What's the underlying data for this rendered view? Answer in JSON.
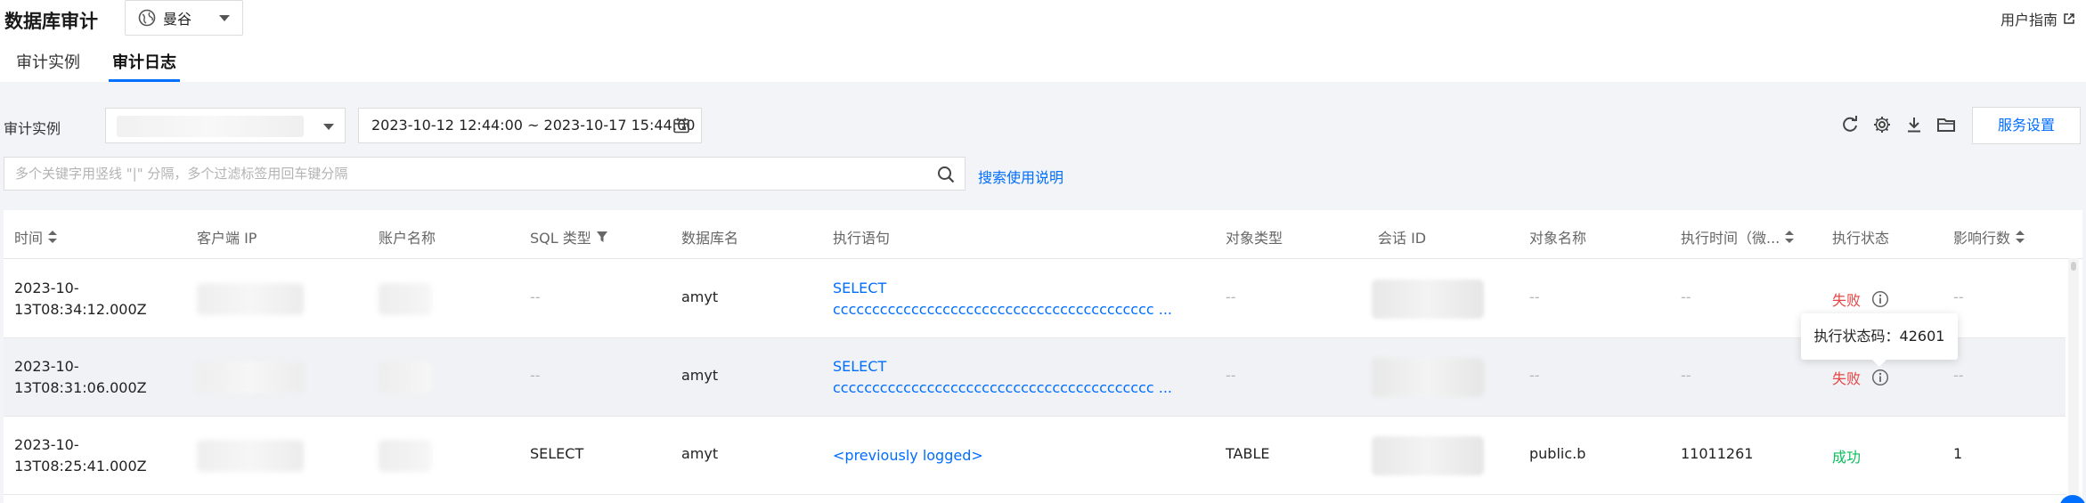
{
  "header": {
    "title": "数据库审计",
    "region": "曼谷",
    "guide": "用户指南"
  },
  "tabs": [
    {
      "label": "审计实例",
      "active": false
    },
    {
      "label": "审计日志",
      "active": true
    }
  ],
  "filters": {
    "instance_label": "审计实例",
    "date_range": "2023-10-12 12:44:00 ~ 2023-10-17 15:44:00",
    "service_button": "服务设置",
    "search_placeholder": "多个关键字用竖线 \"|\" 分隔，多个过滤标签用回车键分隔",
    "search_help": "搜索使用说明"
  },
  "toolbar_icons": [
    "refresh-icon",
    "settings-icon",
    "download-icon",
    "folder-icon"
  ],
  "table": {
    "columns": [
      "时间",
      "客户端 IP",
      "账户名称",
      "SQL 类型",
      "数据库名",
      "执行语句",
      "对象类型",
      "会话 ID",
      "对象名称",
      "执行时间（微...",
      "执行状态",
      "影响行数"
    ],
    "rows": [
      {
        "time_l1": "2023-10-",
        "time_l2": "13T08:34:12.000Z",
        "sql_type": "--",
        "db_name": "amyt",
        "stmt_l1": "SELECT",
        "stmt_l2": "ccccccccccccccccccccccccccccccccccccccccc ...",
        "obj_type": "--",
        "obj_name": "--",
        "exec_time": "--",
        "status": "失败",
        "rows_affected": "--"
      },
      {
        "time_l1": "2023-10-",
        "time_l2": "13T08:31:06.000Z",
        "sql_type": "--",
        "db_name": "amyt",
        "stmt_l1": "SELECT",
        "stmt_l2": "ccccccccccccccccccccccccccccccccccccccccc ...",
        "obj_type": "--",
        "obj_name": "--",
        "exec_time": "--",
        "status": "失败",
        "rows_affected": "--"
      },
      {
        "time_l1": "2023-10-",
        "time_l2": "13T08:25:41.000Z",
        "sql_type": "SELECT",
        "db_name": "amyt",
        "stmt_l1": "<previously logged>",
        "stmt_l2": "",
        "obj_type": "TABLE",
        "obj_name": "public.b",
        "exec_time": "11011261",
        "status": "成功",
        "rows_affected": "1"
      }
    ]
  },
  "tooltip": {
    "text": "执行状态码：42601"
  },
  "colors": {
    "accent": "#006eff",
    "fail": "#e54545",
    "success": "#0abf5b"
  }
}
